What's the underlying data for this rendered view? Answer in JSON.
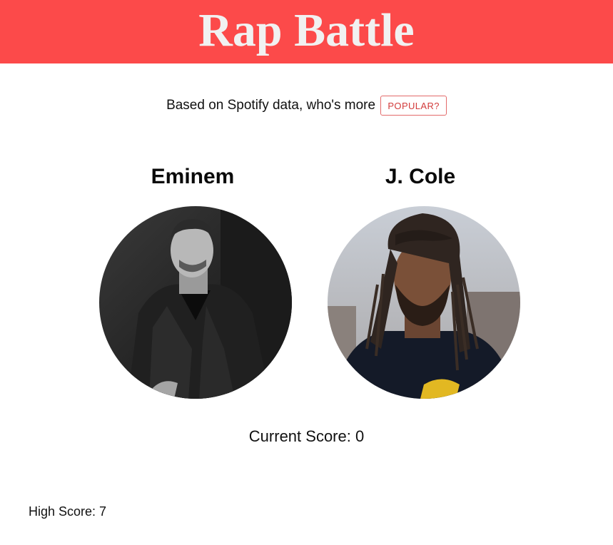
{
  "header": {
    "title": "Rap Battle"
  },
  "prompt": {
    "text": "Based on Spotify data, who's more",
    "button_label": "POPULAR?"
  },
  "artists": [
    {
      "name": "Eminem"
    },
    {
      "name": "J. Cole"
    }
  ],
  "scores": {
    "current": "Current Score: 0",
    "high": "High Score: 7"
  },
  "colors": {
    "header_bg": "#fc4a4a",
    "header_text": "#f1f1f1",
    "button_border": "#e36a6a",
    "button_text": "#d23b3b"
  }
}
